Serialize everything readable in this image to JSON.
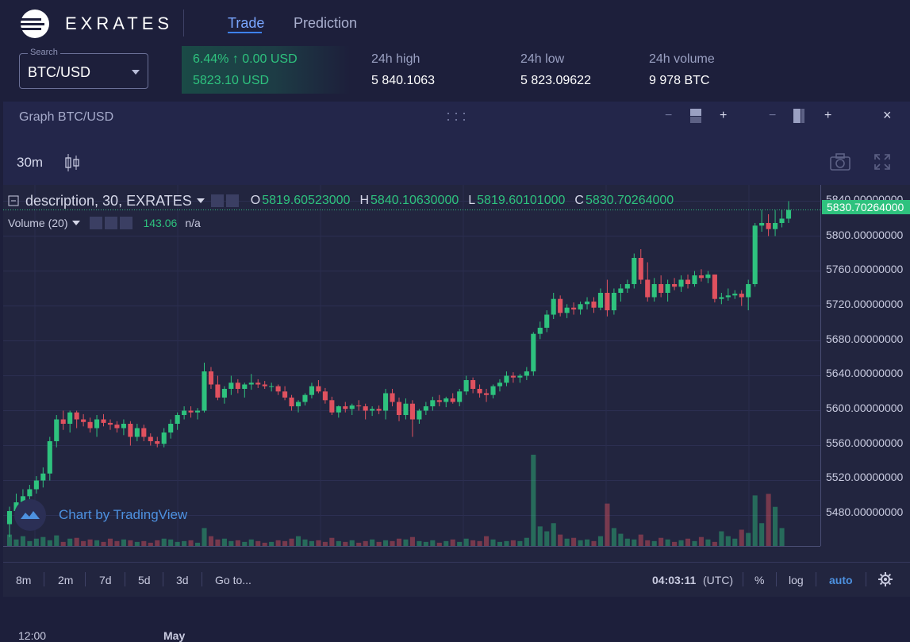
{
  "brand": {
    "name": "EXRATES"
  },
  "nav": {
    "tabs": [
      {
        "label": "Trade",
        "active": true
      },
      {
        "label": "Prediction",
        "active": false
      }
    ]
  },
  "ticker": {
    "search_legend": "Search",
    "search_value": "BTC/USD",
    "change_line": "6.44% ↑  0.00 USD",
    "price_line": "5823.10 USD",
    "stats": [
      {
        "label": "24h high",
        "value": "5 840.1063"
      },
      {
        "label": "24h low",
        "value": "5 823.09622"
      },
      {
        "label": "24h volume",
        "value": "9 978 BTC"
      }
    ]
  },
  "panel": {
    "title": "Graph BTC/USD",
    "controls": {
      "minus": "−",
      "plus": "+",
      "close": "×"
    }
  },
  "toolbar": {
    "interval": "30m"
  },
  "legend": {
    "title": "description, 30, EXRATES",
    "o_key": "O",
    "o_val": "5819.60523000",
    "h_key": "H",
    "h_val": "5840.10630000",
    "l_key": "L",
    "l_val": "5819.60101000",
    "c_key": "C",
    "c_val": "5830.70264000"
  },
  "volume": {
    "label": "Volume (20)",
    "value": "143.06",
    "na": "n/a"
  },
  "price_axis": {
    "labels": [
      "5840.00000000",
      "5800.00000000",
      "5760.00000000",
      "5720.00000000",
      "5680.00000000",
      "5640.00000000",
      "5600.00000000",
      "5560.00000000",
      "5520.00000000",
      "5480.00000000"
    ],
    "last": "5830.70264000"
  },
  "watermark": {
    "text": "Chart by TradingView"
  },
  "time_axis": {
    "labels": [
      "12:00",
      "May"
    ]
  },
  "bottom_bar": {
    "ranges": [
      "8m",
      "2m",
      "7d",
      "5d",
      "3d"
    ],
    "goto": "Go to...",
    "clock": "04:03:11",
    "tz": "(UTC)",
    "pct": "%",
    "log": "log",
    "auto": "auto"
  },
  "colors": {
    "up": "#2ec27e",
    "down": "#e0515f",
    "accent": "#3d82ff",
    "bg": "#1d1f3b"
  },
  "chart_data": {
    "type": "candlestick",
    "symbol": "BTC/USD",
    "interval": "30m",
    "ylim": [
      5445,
      5845
    ],
    "candles": [
      [
        5470,
        5490,
        5455,
        5485
      ],
      [
        5485,
        5505,
        5478,
        5495
      ],
      [
        5495,
        5510,
        5488,
        5502
      ],
      [
        5502,
        5515,
        5495,
        5510
      ],
      [
        5510,
        5525,
        5505,
        5520
      ],
      [
        5520,
        5535,
        5512,
        5528
      ],
      [
        5528,
        5570,
        5520,
        5565
      ],
      [
        5565,
        5595,
        5558,
        5590
      ],
      [
        5590,
        5600,
        5578,
        5585
      ],
      [
        5585,
        5600,
        5575,
        5598
      ],
      [
        5598,
        5600,
        5580,
        5590
      ],
      [
        5590,
        5596,
        5582,
        5587
      ],
      [
        5587,
        5592,
        5575,
        5580
      ],
      [
        5580,
        5595,
        5570,
        5590
      ],
      [
        5590,
        5596,
        5582,
        5586
      ],
      [
        5586,
        5590,
        5578,
        5584
      ],
      [
        5584,
        5588,
        5575,
        5580
      ],
      [
        5580,
        5590,
        5572,
        5585
      ],
      [
        5585,
        5588,
        5560,
        5570
      ],
      [
        5570,
        5585,
        5565,
        5580
      ],
      [
        5580,
        5584,
        5565,
        5570
      ],
      [
        5570,
        5574,
        5560,
        5565
      ],
      [
        5565,
        5570,
        5558,
        5562
      ],
      [
        5562,
        5580,
        5558,
        5575
      ],
      [
        5575,
        5590,
        5568,
        5585
      ],
      [
        5585,
        5598,
        5578,
        5595
      ],
      [
        5595,
        5605,
        5590,
        5600
      ],
      [
        5600,
        5605,
        5592,
        5598
      ],
      [
        5598,
        5603,
        5590,
        5600
      ],
      [
        5600,
        5655,
        5598,
        5645
      ],
      [
        5645,
        5650,
        5625,
        5630
      ],
      [
        5630,
        5640,
        5612,
        5615
      ],
      [
        5615,
        5628,
        5608,
        5625
      ],
      [
        5625,
        5640,
        5618,
        5632
      ],
      [
        5632,
        5636,
        5620,
        5625
      ],
      [
        5625,
        5632,
        5615,
        5630
      ],
      [
        5630,
        5642,
        5624,
        5632
      ],
      [
        5632,
        5636,
        5626,
        5630
      ],
      [
        5630,
        5634,
        5625,
        5628
      ],
      [
        5628,
        5632,
        5622,
        5628
      ],
      [
        5628,
        5630,
        5618,
        5622
      ],
      [
        5622,
        5628,
        5612,
        5615
      ],
      [
        5615,
        5618,
        5600,
        5605
      ],
      [
        5605,
        5612,
        5598,
        5610
      ],
      [
        5610,
        5620,
        5606,
        5618
      ],
      [
        5618,
        5632,
        5614,
        5628
      ],
      [
        5628,
        5635,
        5620,
        5622
      ],
      [
        5622,
        5626,
        5608,
        5612
      ],
      [
        5612,
        5616,
        5595,
        5598
      ],
      [
        5598,
        5606,
        5592,
        5605
      ],
      [
        5605,
        5610,
        5598,
        5602
      ],
      [
        5602,
        5608,
        5595,
        5606
      ],
      [
        5606,
        5612,
        5600,
        5605
      ],
      [
        5605,
        5608,
        5590,
        5600
      ],
      [
        5600,
        5605,
        5594,
        5602
      ],
      [
        5602,
        5606,
        5596,
        5600
      ],
      [
        5600,
        5625,
        5590,
        5620
      ],
      [
        5620,
        5625,
        5605,
        5610
      ],
      [
        5610,
        5615,
        5588,
        5595
      ],
      [
        5595,
        5614,
        5590,
        5608
      ],
      [
        5608,
        5612,
        5570,
        5590
      ],
      [
        5590,
        5602,
        5585,
        5600
      ],
      [
        5600,
        5610,
        5595,
        5605
      ],
      [
        5605,
        5616,
        5600,
        5612
      ],
      [
        5612,
        5618,
        5605,
        5610
      ],
      [
        5610,
        5616,
        5604,
        5614
      ],
      [
        5614,
        5620,
        5608,
        5610
      ],
      [
        5610,
        5625,
        5605,
        5622
      ],
      [
        5622,
        5640,
        5618,
        5635
      ],
      [
        5635,
        5638,
        5620,
        5625
      ],
      [
        5625,
        5630,
        5615,
        5620
      ],
      [
        5620,
        5625,
        5610,
        5618
      ],
      [
        5618,
        5630,
        5614,
        5628
      ],
      [
        5628,
        5636,
        5622,
        5632
      ],
      [
        5632,
        5645,
        5628,
        5640
      ],
      [
        5640,
        5644,
        5632,
        5638
      ],
      [
        5638,
        5642,
        5632,
        5640
      ],
      [
        5640,
        5650,
        5635,
        5645
      ],
      [
        5645,
        5690,
        5640,
        5688
      ],
      [
        5688,
        5702,
        5682,
        5695
      ],
      [
        5695,
        5715,
        5690,
        5710
      ],
      [
        5710,
        5735,
        5705,
        5728
      ],
      [
        5728,
        5732,
        5708,
        5712
      ],
      [
        5712,
        5722,
        5706,
        5718
      ],
      [
        5718,
        5724,
        5710,
        5716
      ],
      [
        5716,
        5725,
        5710,
        5722
      ],
      [
        5722,
        5730,
        5716,
        5725
      ],
      [
        5725,
        5730,
        5712,
        5718
      ],
      [
        5718,
        5740,
        5715,
        5735
      ],
      [
        5735,
        5750,
        5708,
        5715
      ],
      [
        5715,
        5740,
        5710,
        5735
      ],
      [
        5735,
        5745,
        5725,
        5740
      ],
      [
        5740,
        5750,
        5735,
        5745
      ],
      [
        5745,
        5780,
        5740,
        5775
      ],
      [
        5775,
        5785,
        5745,
        5750
      ],
      [
        5750,
        5770,
        5725,
        5730
      ],
      [
        5730,
        5752,
        5725,
        5745
      ],
      [
        5745,
        5755,
        5730,
        5735
      ],
      [
        5735,
        5750,
        5725,
        5745
      ],
      [
        5745,
        5752,
        5738,
        5742
      ],
      [
        5742,
        5755,
        5736,
        5750
      ],
      [
        5750,
        5756,
        5740,
        5745
      ],
      [
        5745,
        5760,
        5742,
        5755
      ],
      [
        5755,
        5762,
        5748,
        5752
      ],
      [
        5752,
        5760,
        5746,
        5756
      ],
      [
        5756,
        5756,
        5724,
        5728
      ],
      [
        5728,
        5735,
        5722,
        5730
      ],
      [
        5730,
        5740,
        5726,
        5732
      ],
      [
        5732,
        5738,
        5728,
        5734
      ],
      [
        5734,
        5738,
        5720,
        5730
      ],
      [
        5730,
        5750,
        5715,
        5745
      ],
      [
        5745,
        5815,
        5742,
        5812
      ],
      [
        5812,
        5830,
        5805,
        5815
      ],
      [
        5815,
        5825,
        5800,
        5808
      ],
      [
        5808,
        5830,
        5800,
        5815
      ],
      [
        5815,
        5830,
        5810,
        5820
      ],
      [
        5820,
        5840,
        5815,
        5830
      ]
    ],
    "volumes": [
      14,
      8,
      12,
      6,
      9,
      11,
      7,
      13,
      5,
      9,
      10,
      6,
      8,
      7,
      5,
      9,
      6,
      8,
      7,
      5,
      6,
      4,
      7,
      9,
      8,
      5,
      6,
      7,
      4,
      22,
      12,
      8,
      9,
      6,
      7,
      5,
      8,
      6,
      4,
      5,
      7,
      6,
      9,
      12,
      8,
      6,
      7,
      5,
      10,
      6,
      5,
      7,
      4,
      6,
      8,
      5,
      7,
      6,
      9,
      8,
      11,
      6,
      5,
      7,
      4,
      6,
      8,
      5,
      9,
      7,
      6,
      12,
      8,
      5,
      6,
      7,
      6,
      10,
      112,
      24,
      18,
      28,
      14,
      9,
      10,
      7,
      8,
      6,
      12,
      52,
      22,
      15,
      9,
      8,
      14,
      7,
      6,
      10,
      8,
      5,
      7,
      9,
      6,
      11,
      8,
      5,
      18,
      12,
      9,
      20,
      16,
      62,
      28,
      64,
      48,
      22
    ]
  }
}
